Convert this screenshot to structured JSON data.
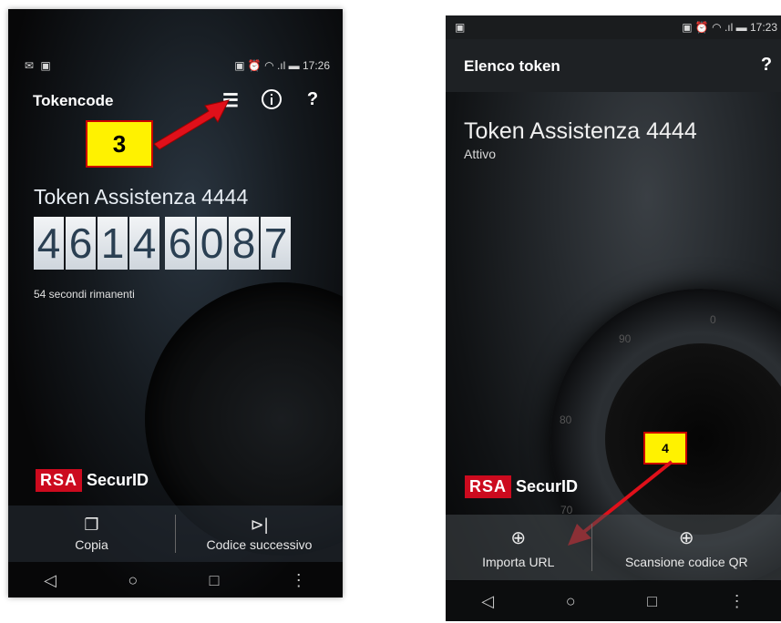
{
  "left_phone": {
    "status_time": "17:26",
    "app_title": "Tokencode",
    "icons": {
      "list": "list-icon",
      "info": "info-icon",
      "help": "help-icon"
    },
    "help_label": "?",
    "token_name": "Token Assistenza 4444",
    "code_group1": [
      "4",
      "6",
      "1",
      "4"
    ],
    "code_group2": [
      "6",
      "0",
      "8",
      "7"
    ],
    "countdown": "54 secondi rimanenti",
    "brand_rsa": "RSA",
    "brand_securid": "SecurID",
    "actions": [
      {
        "label": "Copia",
        "icon": "copy-icon"
      },
      {
        "label": "Codice successivo",
        "icon": "skip-next-icon"
      }
    ],
    "callout": "3"
  },
  "right_phone": {
    "status_time": "17:23",
    "app_title": "Elenco token",
    "help_label": "?",
    "token_name": "Token Assistenza 4444",
    "token_status": "Attivo",
    "brand_rsa": "RSA",
    "brand_securid": "SecurID",
    "actions": [
      {
        "label": "Importa URL",
        "icon": "add-circle-icon"
      },
      {
        "label": "Scansione codice QR",
        "icon": "add-circle-icon"
      }
    ],
    "callout": "4",
    "dial_marks": [
      "90",
      "0",
      "80",
      "70"
    ]
  },
  "colors": {
    "rsa_red": "#cc0a1e",
    "callout_yellow": "#fff200",
    "arrow_red": "#e0101a"
  }
}
